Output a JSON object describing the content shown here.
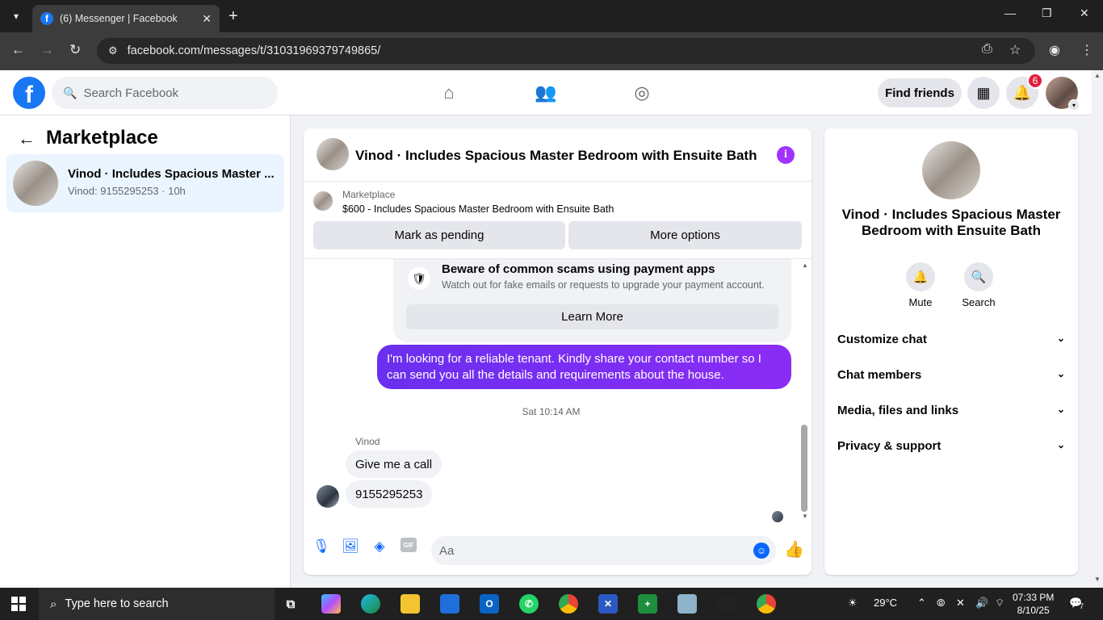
{
  "browser": {
    "tab_title": "(6) Messenger | Facebook",
    "url": "facebook.com/messages/t/31031969379749865/"
  },
  "header": {
    "search_placeholder": "Search Facebook",
    "find_friends": "Find friends",
    "notification_count": "6"
  },
  "left_panel": {
    "title": "Marketplace",
    "conversation": {
      "name": "Vinod · Includes Spacious Master ...",
      "preview": "Vinod: 9155295253 · 10h"
    }
  },
  "chat": {
    "title": "Vinod · Includes Spacious Master Bedroom with Ensuite Bath",
    "marketplace_label": "Marketplace",
    "listing": "$600 - Includes Spacious Master Bedroom with Ensuite Bath",
    "mark_pending": "Mark as pending",
    "more_options": "More options",
    "warning_title": "Beware of common scams using payment apps",
    "warning_text": "Watch out for fake emails or requests to upgrade your payment account.",
    "learn_more": "Learn More",
    "outgoing_message": "I'm looking for a reliable tenant. Kindly share your contact number so I can send you all the details and requirements about the house.",
    "timestamp": "Sat 10:14 AM",
    "sender_name": "Vinod",
    "incoming_1": "Give me a call",
    "incoming_2": "9155295253",
    "composer_placeholder": "Aa",
    "gif_label": "GIF"
  },
  "right_panel": {
    "name": "Vinod · Includes Spacious Master Bedroom with Ensuite Bath",
    "mute": "Mute",
    "search": "Search",
    "sections": [
      "Customize chat",
      "Chat members",
      "Media, files and links",
      "Privacy & support"
    ]
  },
  "taskbar": {
    "search_placeholder": "Type here to search",
    "weather": "29°C",
    "time": "07:33 PM",
    "date": "8/10/25",
    "notif_count": "7"
  }
}
